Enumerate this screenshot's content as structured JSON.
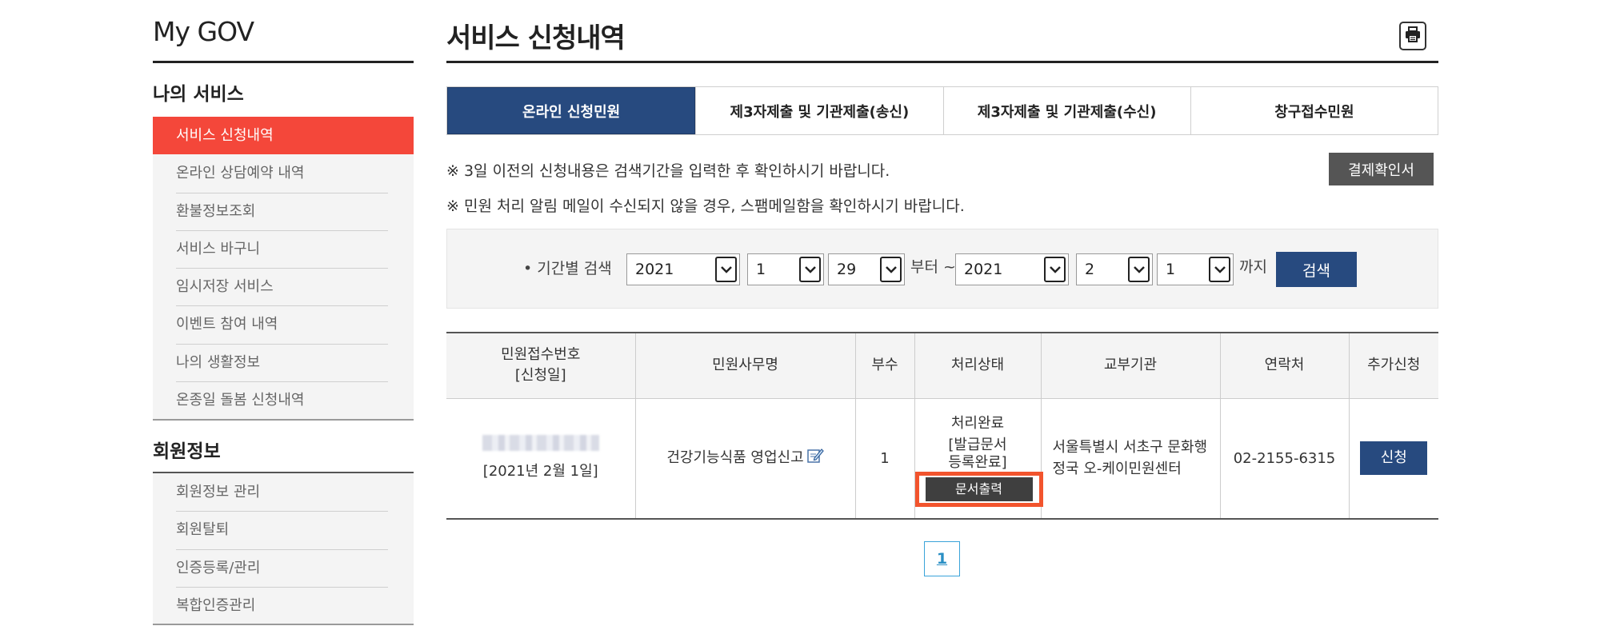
{
  "sidebar": {
    "brand": "My GOV",
    "section1_title": "나의 서비스",
    "section1_items": [
      "서비스 신청내역",
      "온라인 상담예약 내역",
      "환불정보조회",
      "서비스 바구니",
      "임시저장 서비스",
      "이벤트 참여 내역",
      "나의 생활정보",
      "온종일 돌봄 신청내역"
    ],
    "section2_title": "회원정보",
    "section2_items": [
      "회원정보 관리",
      "회원탈퇴",
      "인증등록/관리",
      "복합인증관리"
    ]
  },
  "main": {
    "title": "서비스 신청내역",
    "print_icon": "printer-icon",
    "tabs": [
      "온라인 신청민원",
      "제3자제출 및 기관제출(송신)",
      "제3자제출 및 기관제출(수신)",
      "창구접수민원"
    ],
    "notice1": "※ 3일 이전의 신청내용은 검색기간을 입력한 후 확인하시기 바랍니다.",
    "notice2": "※ 민원 처리 알림 메일이 수신되지 않을 경우, 스팸메일함을 확인하시기 바랍니다.",
    "receipt_button": "결제확인서",
    "search": {
      "label": "• 기간별 검색",
      "from_year": "2021",
      "from_month": "1",
      "from_day": "29",
      "from_text": "부터 ~",
      "to_year": "2021",
      "to_month": "2",
      "to_day": "1",
      "to_text": "까지",
      "button": "검색"
    },
    "table": {
      "headers": [
        "민원접수번호",
        "[신청일]",
        "민원사무명",
        "부수",
        "처리상태",
        "교부기관",
        "연락처",
        "추가신청"
      ],
      "row": {
        "date": "[2021년 2월 1일]",
        "service": "건강기능식품 영업신고",
        "copies": "1",
        "status1": "처리완료",
        "status2": "[발급문서",
        "status3": "등록완료]",
        "print_doc": "문서출력",
        "agency": "서울특별시 서초구 문화행정국 오-케이민원센터",
        "contact": "02-2155-6315",
        "apply": "신청"
      }
    },
    "pagination": [
      "1"
    ]
  },
  "colors": {
    "active_menu": "#f4473a",
    "primary_blue": "#274a7f",
    "highlight_orange": "#f2542d",
    "dark_button": "#555555",
    "link_blue": "#2a8fc4"
  }
}
